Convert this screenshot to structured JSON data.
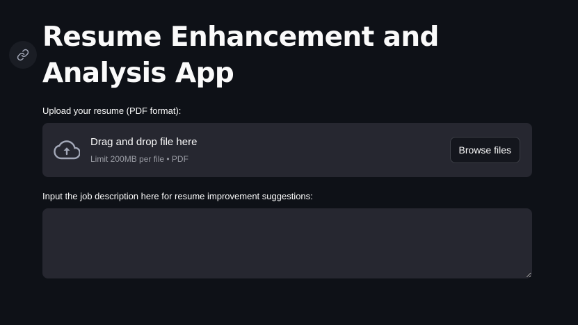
{
  "app": {
    "title": "Resume Enhancement and Analysis App"
  },
  "uploader": {
    "label": "Upload your resume (PDF format):",
    "drop_text": "Drag and drop file here",
    "limit_text": "Limit 200MB per file • PDF",
    "browse_label": "Browse files",
    "icon": "cloud-upload-icon"
  },
  "job_description": {
    "label": "Input the job description here for resume improvement suggestions:",
    "value": "",
    "placeholder": ""
  },
  "anchor": {
    "icon": "link-icon"
  },
  "colors": {
    "background": "#0e1117",
    "surface": "#262730",
    "text": "#fafafa",
    "muted": "#9a9ca4"
  }
}
